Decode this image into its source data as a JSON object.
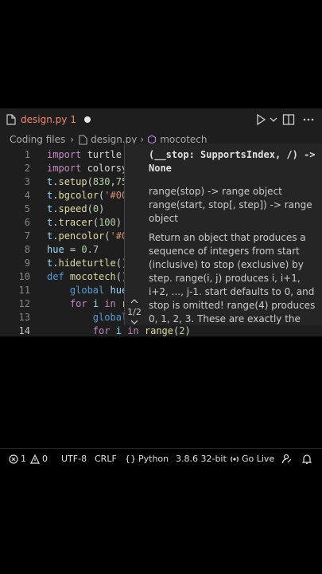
{
  "tab": {
    "filename": "design.py",
    "badge": "1"
  },
  "breadcrumb": {
    "folder": "Coding files",
    "file": "design.py",
    "symbol": "mocotech"
  },
  "lines": [
    {
      "num": "1",
      "code": [
        {
          "t": "kw",
          "v": "import"
        },
        {
          "t": "",
          "v": " turtle"
        }
      ]
    },
    {
      "num": "2",
      "code": [
        {
          "t": "kw",
          "v": "import"
        },
        {
          "t": "",
          "v": " colorsy"
        }
      ]
    },
    {
      "num": "3",
      "code": [
        {
          "t": "vr",
          "v": "t"
        },
        {
          "t": "",
          "v": "."
        },
        {
          "t": "fn",
          "v": "setup"
        },
        {
          "t": "",
          "v": "("
        },
        {
          "t": "nm",
          "v": "830"
        },
        {
          "t": "",
          "v": ","
        },
        {
          "t": "nm",
          "v": "75"
        }
      ]
    },
    {
      "num": "4",
      "code": [
        {
          "t": "vr",
          "v": "t"
        },
        {
          "t": "",
          "v": "."
        },
        {
          "t": "fn",
          "v": "bgcolor"
        },
        {
          "t": "",
          "v": "("
        },
        {
          "t": "st",
          "v": "'#00"
        }
      ]
    },
    {
      "num": "5",
      "code": [
        {
          "t": "vr",
          "v": "t"
        },
        {
          "t": "",
          "v": "."
        },
        {
          "t": "fn",
          "v": "speed"
        },
        {
          "t": "",
          "v": "("
        },
        {
          "t": "nm",
          "v": "0"
        },
        {
          "t": "",
          "v": ")"
        }
      ]
    },
    {
      "num": "6",
      "code": [
        {
          "t": "vr",
          "v": "t"
        },
        {
          "t": "",
          "v": "."
        },
        {
          "t": "fn",
          "v": "tracer"
        },
        {
          "t": "",
          "v": "("
        },
        {
          "t": "nm",
          "v": "100"
        },
        {
          "t": "",
          "v": ")"
        }
      ]
    },
    {
      "num": "7",
      "code": [
        {
          "t": "vr",
          "v": "t"
        },
        {
          "t": "",
          "v": "."
        },
        {
          "t": "fn",
          "v": "pencolor"
        },
        {
          "t": "",
          "v": "("
        },
        {
          "t": "st",
          "v": "'#0"
        }
      ]
    },
    {
      "num": "8",
      "code": [
        {
          "t": "vr",
          "v": "hue"
        },
        {
          "t": "",
          "v": " = "
        },
        {
          "t": "nm",
          "v": "0.7"
        }
      ]
    },
    {
      "num": "9",
      "code": [
        {
          "t": "vr",
          "v": "t"
        },
        {
          "t": "",
          "v": "."
        },
        {
          "t": "fn",
          "v": "hideturtle"
        },
        {
          "t": "",
          "v": "()"
        }
      ]
    },
    {
      "num": "10",
      "code": [
        {
          "t": "bl",
          "v": "def"
        },
        {
          "t": "",
          "v": " "
        },
        {
          "t": "fn",
          "v": "mocotech"
        },
        {
          "t": "",
          "v": "()"
        }
      ]
    },
    {
      "num": "11",
      "code": [
        {
          "t": "",
          "v": "    "
        },
        {
          "t": "bl",
          "v": "global"
        },
        {
          "t": "",
          "v": " "
        },
        {
          "t": "vr",
          "v": "hue"
        }
      ]
    },
    {
      "num": "12",
      "code": [
        {
          "t": "",
          "v": "    "
        },
        {
          "t": "kw",
          "v": "for"
        },
        {
          "t": "",
          "v": " "
        },
        {
          "t": "vr",
          "v": "i"
        },
        {
          "t": "",
          "v": " "
        },
        {
          "t": "kw",
          "v": "in"
        },
        {
          "t": "",
          "v": " "
        },
        {
          "t": "fn",
          "v": "r"
        }
      ]
    },
    {
      "num": "13",
      "code": [
        {
          "t": "",
          "v": "        "
        },
        {
          "t": "bl",
          "v": "global"
        }
      ]
    },
    {
      "num": "14",
      "code": [
        {
          "t": "",
          "v": "        "
        },
        {
          "t": "kw",
          "v": "for"
        },
        {
          "t": "",
          "v": " "
        },
        {
          "t": "vr",
          "v": "i"
        },
        {
          "t": "",
          "v": " "
        },
        {
          "t": "kw",
          "v": "in"
        },
        {
          "t": "",
          "v": " "
        },
        {
          "t": "fn",
          "v": "range"
        },
        {
          "t": "",
          "v": "("
        },
        {
          "t": "nm",
          "v": "2"
        },
        {
          "t": "",
          "v": ")"
        }
      ]
    }
  ],
  "hover": {
    "signature": "(__stop: SupportsIndex, /) -> None",
    "para1": "range(stop) -> range object range(start, stop[, step]) -> range object",
    "para2": "Return an object that produces a sequence of integers from start (inclusive) to stop (exclusive) by step. range(i, j) produces i, i+1, i+2, ..., j-1. start defaults to 0, and stop is omitted! range(4) produces 0, 1, 2, 3. These are exactly the valid indices for",
    "overload": "1/2"
  },
  "status": {
    "errors": "1",
    "warnings": "0",
    "encoding": "UTF-8",
    "eol": "CRLF",
    "language": "Python",
    "interpreter": "3.8.6 32-bit",
    "golive": "Go Live"
  },
  "colors": {
    "accent": "#f48771",
    "editor_bg": "#1e1e1e",
    "hover_bg": "#252526"
  }
}
